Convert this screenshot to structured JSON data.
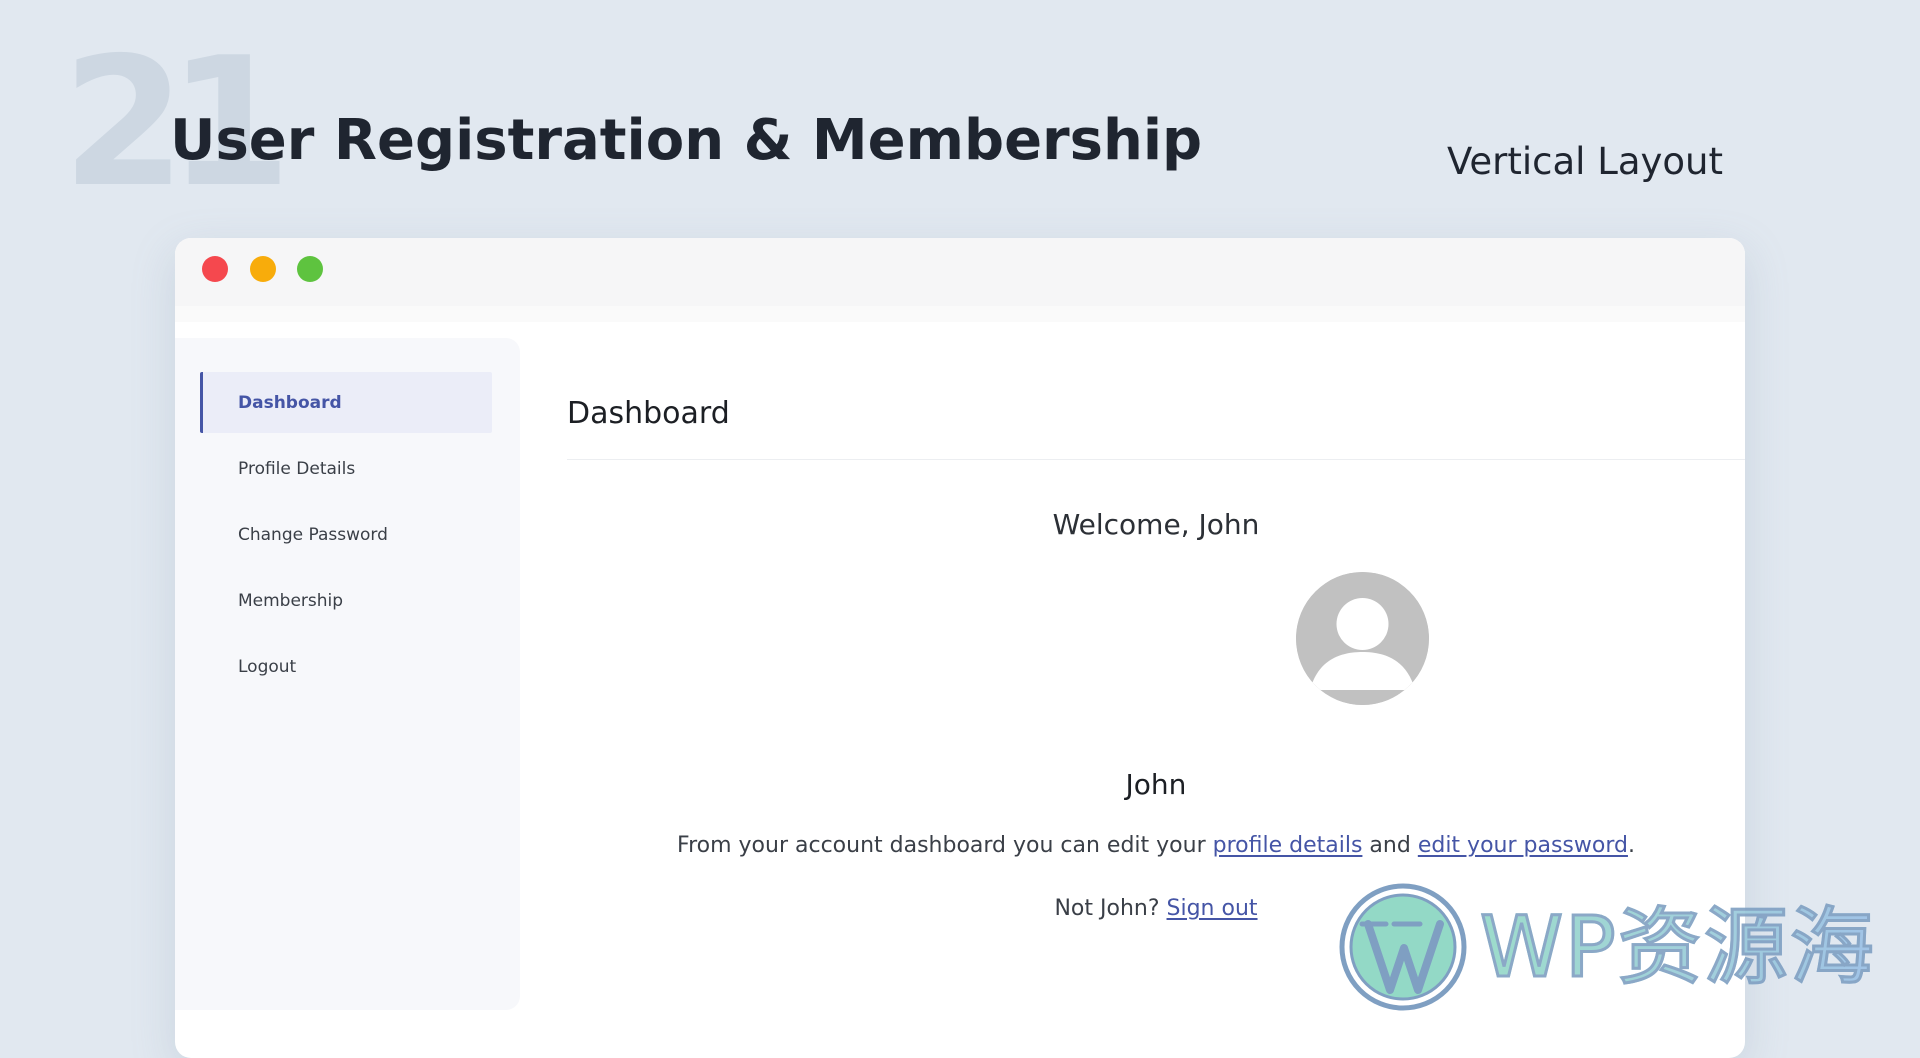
{
  "slide": {
    "number": "21",
    "title": "User Registration & Membership",
    "subtitle": "Vertical Layout"
  },
  "window": {
    "controls": [
      "close",
      "minimize",
      "maximize"
    ]
  },
  "sidebar": {
    "items": [
      {
        "label": "Dashboard",
        "active": true
      },
      {
        "label": "Profile Details",
        "active": false
      },
      {
        "label": "Change Password",
        "active": false
      },
      {
        "label": "Membership",
        "active": false
      },
      {
        "label": "Logout",
        "active": false
      }
    ]
  },
  "main": {
    "heading": "Dashboard",
    "welcome": "Welcome, John",
    "avatar_icon": "user-avatar-placeholder-icon",
    "username": "John",
    "info": {
      "prefix": "From your account dashboard you can edit your ",
      "link1": "profile details",
      "middle": " and ",
      "link2": "edit your password",
      "suffix": "."
    },
    "signout": {
      "prefix": "Not John? ",
      "link": "Sign out"
    }
  },
  "watermark": {
    "text": "WP资源海",
    "icon": "wordpress-logo-icon"
  },
  "colors": {
    "accent": "#4555a6",
    "background": "#e1e8f0",
    "close": "#f5484e",
    "minimize": "#f8ac0b",
    "maximize": "#5ec33f"
  }
}
